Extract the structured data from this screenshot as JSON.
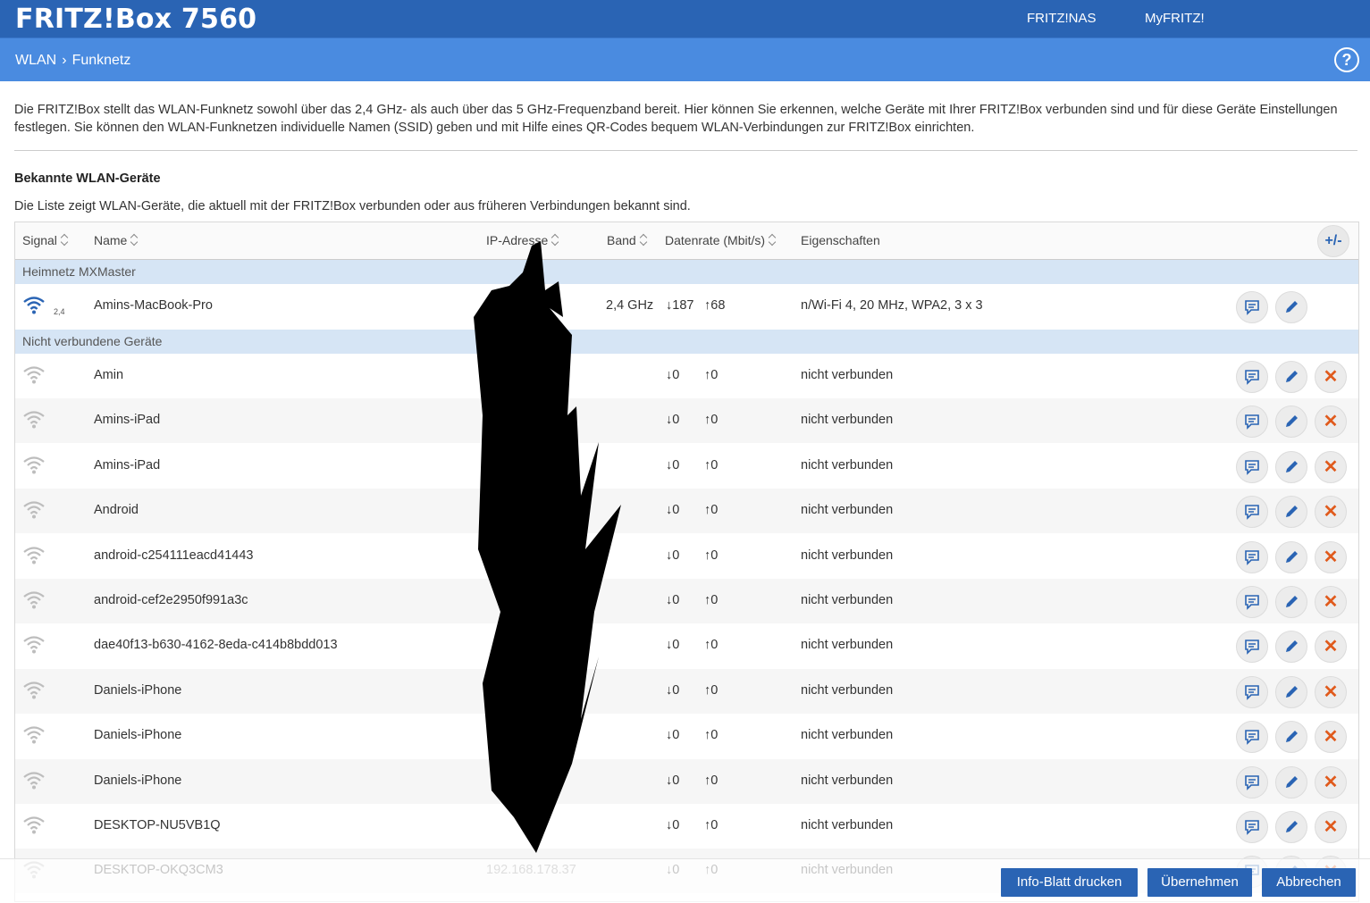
{
  "header": {
    "brand": "FRITZ!Box 7560",
    "links": [
      "FRITZ!NAS",
      "MyFRITZ!"
    ]
  },
  "breadcrumb": {
    "section": "WLAN",
    "page": "Funknetz",
    "help": "?"
  },
  "intro": "Die FRITZ!Box stellt das WLAN-Funknetz sowohl über das 2,4 GHz- als auch über das 5 GHz-Frequenzband bereit. Hier können Sie erkennen, welche Geräte mit Ihrer FRITZ!Box verbunden sind und für diese Geräte Einstellungen festlegen. Sie können den WLAN-Funknetzen individuelle Namen (SSID) geben und mit Hilfe eines QR-Codes bequem WLAN-Verbindungen zur FRITZ!Box einrichten.",
  "section": {
    "title": "Bekannte WLAN-Geräte",
    "description": "Die Liste zeigt WLAN-Geräte, die aktuell mit der FRITZ!Box verbunden oder aus früheren Verbindungen bekannt sind."
  },
  "table": {
    "columns": [
      "Signal",
      "Name",
      "IP-Adresse",
      "Band",
      "Datenrate (Mbit/s)",
      "Eigenschaften"
    ],
    "expand_label": "+/-",
    "groups": {
      "connected": "Heimnetz MXMaster",
      "disconnected": "Nicht verbundene Geräte"
    },
    "connected_rows": [
      {
        "band_small": "2,4",
        "name": "Amins-MacBook-Pro",
        "band": "2,4 GHz",
        "down": "↓187",
        "up": "↑68",
        "props": "n/Wi-Fi 4, 20 MHz, WPA2, 3 x 3"
      }
    ],
    "disconnected_rows": [
      {
        "name": "Amin",
        "ip": "",
        "down": "↓0",
        "up": "↑0",
        "props": "nicht verbunden"
      },
      {
        "name": "Amins-iPad",
        "ip": "",
        "down": "↓0",
        "up": "↑0",
        "props": "nicht verbunden"
      },
      {
        "name": "Amins-iPad",
        "ip": "",
        "down": "↓0",
        "up": "↑0",
        "props": "nicht verbunden"
      },
      {
        "name": "Android",
        "ip": "",
        "down": "↓0",
        "up": "↑0",
        "props": "nicht verbunden"
      },
      {
        "name": "android-c254111eacd41443",
        "ip": "",
        "down": "↓0",
        "up": "↑0",
        "props": "nicht verbunden"
      },
      {
        "name": "android-cef2e2950f991a3c",
        "ip": "",
        "down": "↓0",
        "up": "↑0",
        "props": "nicht verbunden"
      },
      {
        "name": "dae40f13-b630-4162-8eda-c414b8bdd013",
        "ip": "",
        "down": "↓0",
        "up": "↑0",
        "props": "nicht verbunden"
      },
      {
        "name": "Daniels-iPhone",
        "ip": "",
        "down": "↓0",
        "up": "↑0",
        "props": "nicht verbunden"
      },
      {
        "name": "Daniels-iPhone",
        "ip": "",
        "down": "↓0",
        "up": "↑0",
        "props": "nicht verbunden"
      },
      {
        "name": "Daniels-iPhone",
        "ip": "",
        "down": "↓0",
        "up": "↑0",
        "props": "nicht verbunden"
      },
      {
        "name": "DESKTOP-NU5VB1Q",
        "ip": "",
        "down": "↓0",
        "up": "↑0",
        "props": "nicht verbunden"
      },
      {
        "name": "DESKTOP-OKQ3CM3",
        "ip": "192.168.178.37",
        "down": "↓0",
        "up": "↑0",
        "props": "nicht verbunden"
      }
    ]
  },
  "footer": {
    "print": "Info-Blatt drucken",
    "apply": "Übernehmen",
    "cancel": "Abbrechen"
  },
  "colors": {
    "topbar": "#2a64b4",
    "subbar": "#4a8be0",
    "group": "#d6e5f5",
    "delete": "#e05a1c"
  }
}
